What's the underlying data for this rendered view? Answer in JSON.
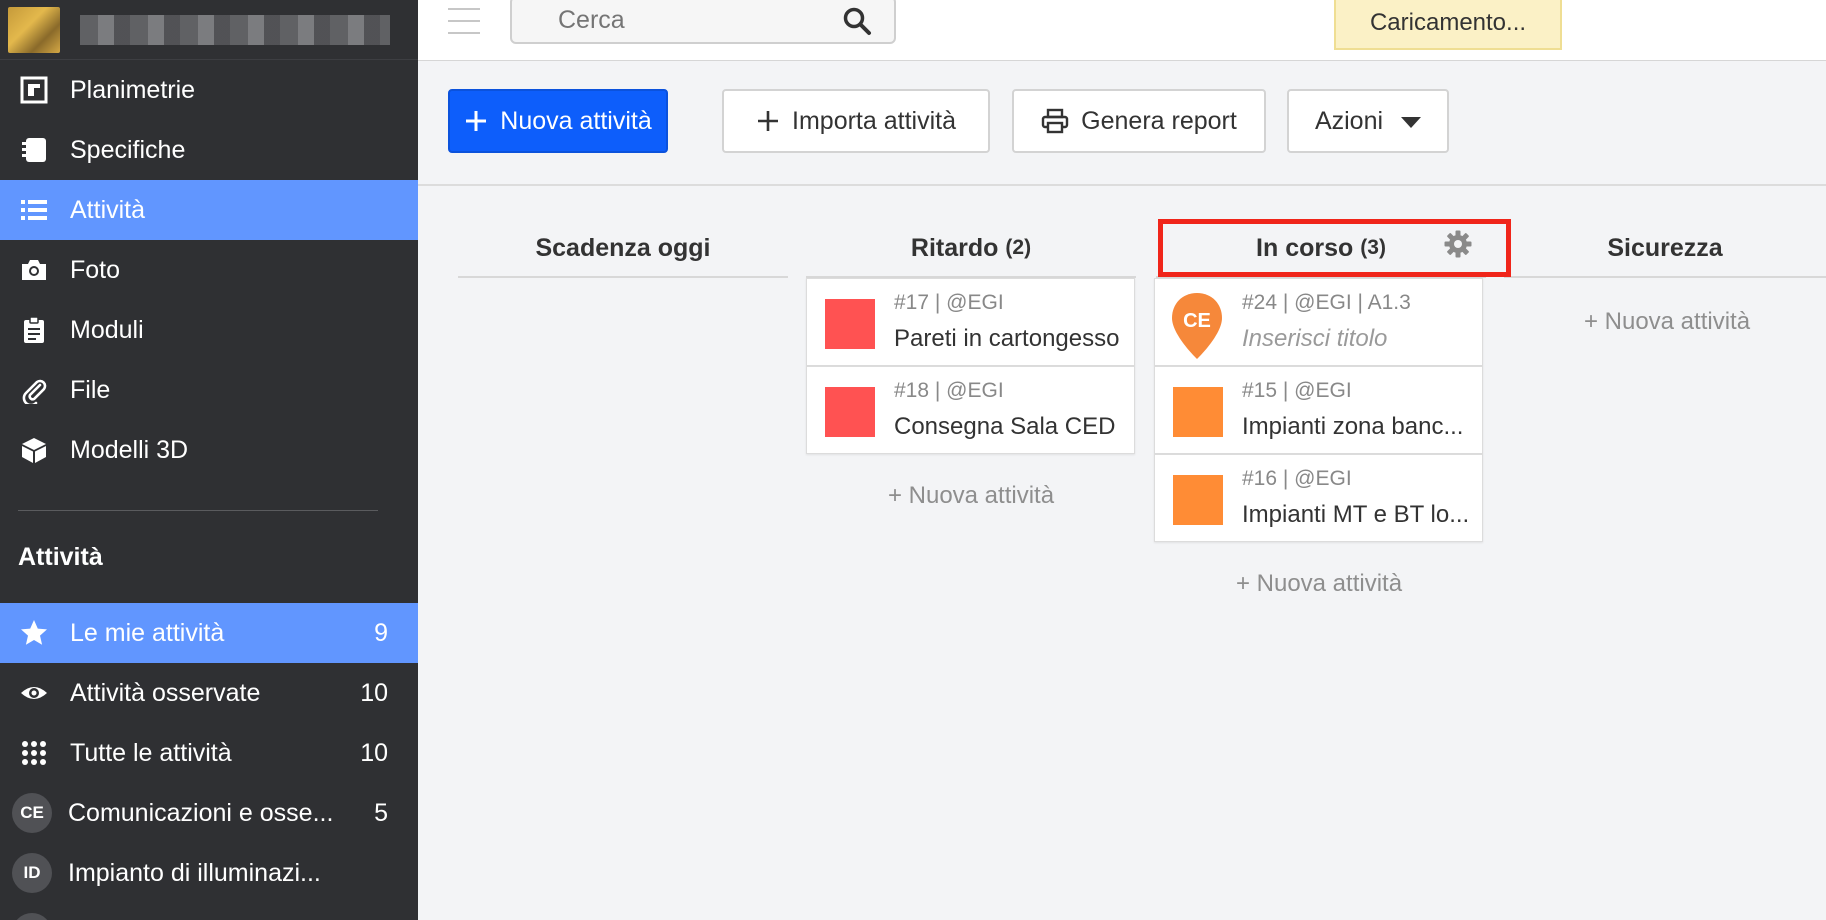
{
  "sidebar": {
    "nav": [
      {
        "label": "Planimetrie",
        "icon": "floorplan-icon"
      },
      {
        "label": "Specifiche",
        "icon": "notebook-icon"
      },
      {
        "label": "Attività",
        "icon": "list-icon",
        "active": true
      },
      {
        "label": "Foto",
        "icon": "camera-icon"
      },
      {
        "label": "Moduli",
        "icon": "clipboard-icon"
      },
      {
        "label": "File",
        "icon": "paperclip-icon"
      },
      {
        "label": "Modelli 3D",
        "icon": "cube-icon"
      }
    ],
    "section_title": "Attività",
    "filters": [
      {
        "label": "Le mie attività",
        "count": "9",
        "icon": "star-icon",
        "active": true
      },
      {
        "label": "Attività osservate",
        "count": "10",
        "icon": "eye-icon"
      },
      {
        "label": "Tutte le attività",
        "count": "10",
        "icon": "grid-dots-icon"
      },
      {
        "label": "Comunicazioni e osse...",
        "count": "5",
        "badge": "CE"
      },
      {
        "label": "Impianto di illuminazi...",
        "count": "",
        "badge": "ID"
      }
    ]
  },
  "topbar": {
    "search_placeholder": "Cerca",
    "loading_text": "Caricamento..."
  },
  "toolbar": {
    "new_task": "Nuova attività",
    "import_tasks": "Importa attività",
    "generate_report": "Genera report",
    "actions": "Azioni"
  },
  "board": {
    "columns": [
      {
        "title": "Scadenza oggi",
        "count": ""
      },
      {
        "title": "Ritardo",
        "count": "(2)"
      },
      {
        "title": "In corso",
        "count": "(3)"
      },
      {
        "title": "Sicurezza",
        "count": ""
      }
    ],
    "cards": {
      "ritardo": [
        {
          "meta": "#17 | @EGI",
          "title": "Pareti in cartongesso",
          "color": "#ff5252"
        },
        {
          "meta": "#18 | @EGI",
          "title": "Consegna Sala CED",
          "color": "#ff5252"
        }
      ],
      "in_corso": [
        {
          "meta": "#24 | @EGI | A1.3",
          "title": "Inserisci titolo",
          "pin_label": "CE",
          "color": "#f6883a"
        },
        {
          "meta": "#15 | @EGI",
          "title": "Impianti zona banc...",
          "color": "#ff8c35"
        },
        {
          "meta": "#16 | @EGI",
          "title": "Impianti MT e BT lo...",
          "color": "#ff8c35"
        }
      ]
    },
    "add_task_label": "+ Nuova attività"
  },
  "colors": {
    "sidebar_bg": "#2f3033",
    "active_item": "#6196ff",
    "primary_button": "#0d5efb",
    "highlight": "#f0251a"
  }
}
